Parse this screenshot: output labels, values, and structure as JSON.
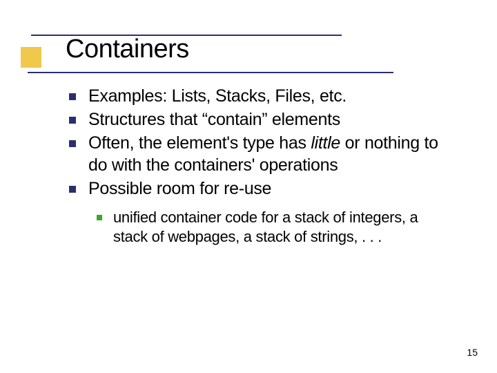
{
  "slide": {
    "title": "Containers",
    "page_number": "15"
  },
  "bullets": {
    "b1": "Examples:  Lists, Stacks, Files, etc.",
    "b2": "Structures that “contain” elements",
    "b3_pre": "Often, the element's type has ",
    "b3_italic": "little",
    "b3_post": " or nothing to do with the containers' operations",
    "b4": "Possible room for re-use",
    "sub1": "unified container code for a stack of integers, a stack of webpages, a stack of strings, . . ."
  }
}
